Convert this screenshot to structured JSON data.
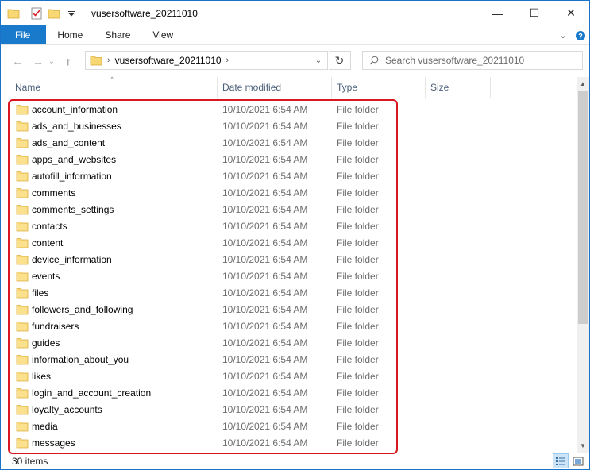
{
  "window": {
    "title": "vusersoftware_20211010",
    "controls": {
      "minimize": "—",
      "maximize": "☐",
      "close": "✕"
    }
  },
  "quick_access": {
    "icons": [
      "folder-icon",
      "properties-checklist-icon",
      "new-folder-icon",
      "customize-dropdown-icon"
    ]
  },
  "ribbon": {
    "tabs": [
      "File",
      "Home",
      "Share",
      "View"
    ],
    "expand_label": "⌄",
    "help_label": "?"
  },
  "address": {
    "back": "←",
    "forward": "→",
    "recent": "⌄",
    "up": "↑",
    "path": "vusersoftware_20211010",
    "chevron": "›",
    "dropdown": "⌄",
    "refresh": "↻"
  },
  "search": {
    "placeholder": "Search vusersoftware_20211010"
  },
  "columns": {
    "name": "Name",
    "date": "Date modified",
    "type": "Type",
    "size": "Size",
    "sort_indicator": "^"
  },
  "files": [
    {
      "name": "account_information",
      "date": "10/10/2021 6:54 AM",
      "type": "File folder"
    },
    {
      "name": "ads_and_businesses",
      "date": "10/10/2021 6:54 AM",
      "type": "File folder"
    },
    {
      "name": "ads_and_content",
      "date": "10/10/2021 6:54 AM",
      "type": "File folder"
    },
    {
      "name": "apps_and_websites",
      "date": "10/10/2021 6:54 AM",
      "type": "File folder"
    },
    {
      "name": "autofill_information",
      "date": "10/10/2021 6:54 AM",
      "type": "File folder"
    },
    {
      "name": "comments",
      "date": "10/10/2021 6:54 AM",
      "type": "File folder"
    },
    {
      "name": "comments_settings",
      "date": "10/10/2021 6:54 AM",
      "type": "File folder"
    },
    {
      "name": "contacts",
      "date": "10/10/2021 6:54 AM",
      "type": "File folder"
    },
    {
      "name": "content",
      "date": "10/10/2021 6:54 AM",
      "type": "File folder"
    },
    {
      "name": "device_information",
      "date": "10/10/2021 6:54 AM",
      "type": "File folder"
    },
    {
      "name": "events",
      "date": "10/10/2021 6:54 AM",
      "type": "File folder"
    },
    {
      "name": "files",
      "date": "10/10/2021 6:54 AM",
      "type": "File folder"
    },
    {
      "name": "followers_and_following",
      "date": "10/10/2021 6:54 AM",
      "type": "File folder"
    },
    {
      "name": "fundraisers",
      "date": "10/10/2021 6:54 AM",
      "type": "File folder"
    },
    {
      "name": "guides",
      "date": "10/10/2021 6:54 AM",
      "type": "File folder"
    },
    {
      "name": "information_about_you",
      "date": "10/10/2021 6:54 AM",
      "type": "File folder"
    },
    {
      "name": "likes",
      "date": "10/10/2021 6:54 AM",
      "type": "File folder"
    },
    {
      "name": "login_and_account_creation",
      "date": "10/10/2021 6:54 AM",
      "type": "File folder"
    },
    {
      "name": "loyalty_accounts",
      "date": "10/10/2021 6:54 AM",
      "type": "File folder"
    },
    {
      "name": "media",
      "date": "10/10/2021 6:54 AM",
      "type": "File folder"
    },
    {
      "name": "messages",
      "date": "10/10/2021 6:54 AM",
      "type": "File folder"
    }
  ],
  "status": {
    "item_count": "30 items"
  },
  "colors": {
    "accent": "#1979ca",
    "highlight_border": "#d9171f",
    "folder": "#f8d775",
    "header_text": "#4c607a"
  }
}
